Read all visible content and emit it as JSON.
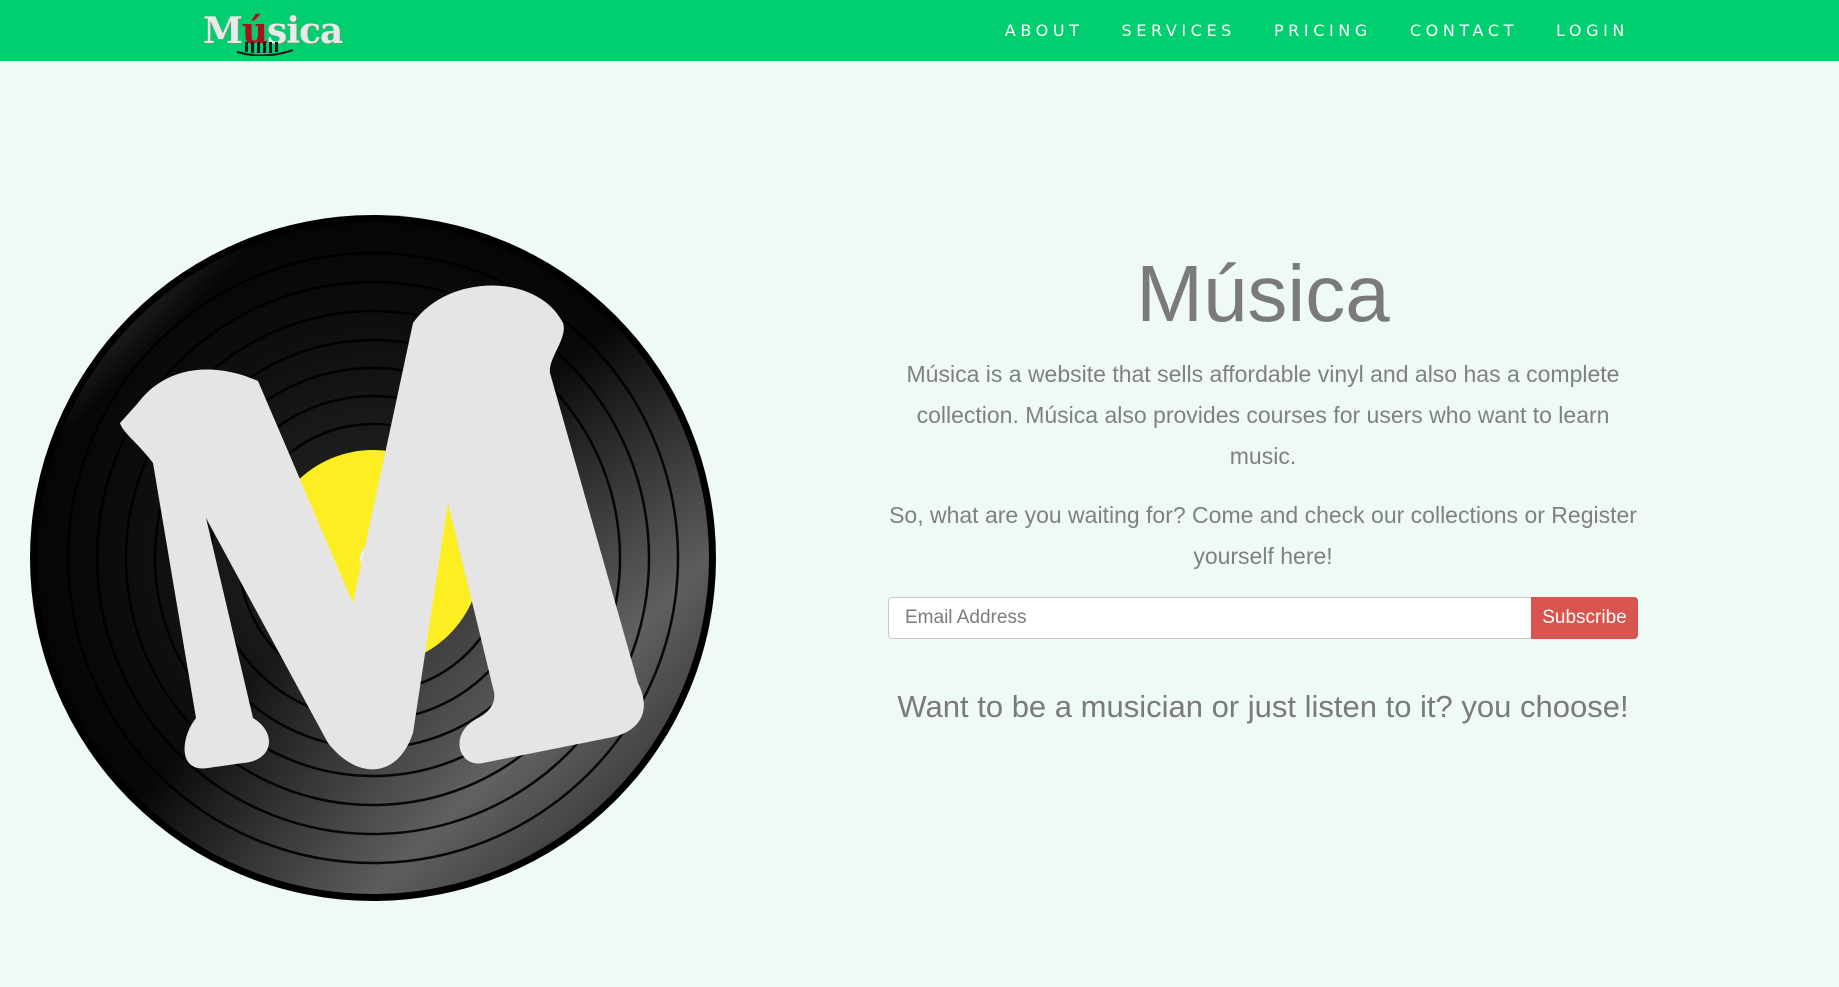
{
  "nav": {
    "brand_prefix": "M",
    "brand_accent": "ú",
    "brand_suffix": "sica",
    "links": [
      "ABOUT",
      "SERVICES",
      "PRICING",
      "CONTACT",
      "LOGIN"
    ]
  },
  "hero": {
    "title": "Música",
    "paragraph1": "Música is a website that sells affordable vinyl and also has a complete collection. Música also provides courses for users who want to learn music.",
    "paragraph2": "So, what are you waiting for? Come and check our collections or Register yourself here!",
    "email_placeholder": "Email Address",
    "email_value": "",
    "subscribe_label": "Subscribe",
    "tagline": "Want to be a musician or just listen to it? you choose!"
  },
  "illustration": {
    "icon": "vinyl-record-m-logo-icon",
    "letter": "M"
  },
  "colors": {
    "navbar": "#00cf70",
    "background": "#f0faf5",
    "subscribe_button": "#d9534f",
    "record_label": "#fcee21",
    "brand_accent": "#a3141a"
  }
}
